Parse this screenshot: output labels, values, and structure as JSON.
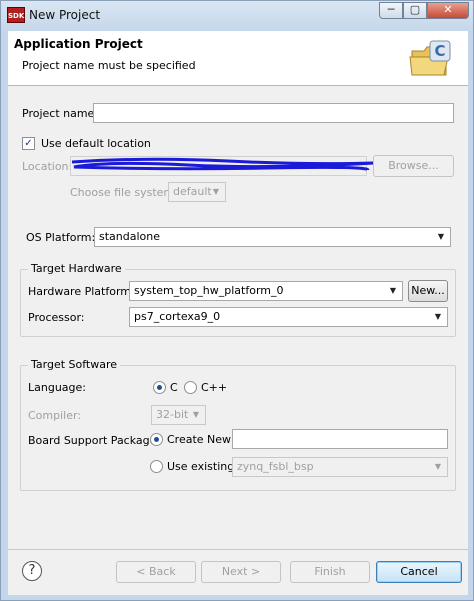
{
  "window": {
    "title": "New Project",
    "app_icon_text": "SDK",
    "min_glyph": "─",
    "max_glyph": "▢",
    "close_glyph": "✕"
  },
  "header": {
    "title": "Application Project",
    "message": "Project name must be specified",
    "icon": "folder-c-icon"
  },
  "project": {
    "name_label": "Project name:",
    "name_value": "",
    "use_default_label": "Use default location",
    "use_default_checked": true,
    "location_label": "Location:",
    "location_value": "",
    "browse_label": "Browse...",
    "file_system_label": "Choose file system:",
    "file_system_value": "default"
  },
  "os_platform": {
    "label": "OS Platform:",
    "value": "standalone"
  },
  "target_hardware": {
    "title": "Target Hardware",
    "platform_label": "Hardware Platform:",
    "platform_value": "system_top_hw_platform_0",
    "new_button": "New...",
    "processor_label": "Processor:",
    "processor_value": "ps7_cortexa9_0"
  },
  "target_software": {
    "title": "Target Software",
    "language_label": "Language:",
    "lang_c": "C",
    "lang_cpp": "C++",
    "selected_language": "C",
    "compiler_label": "Compiler:",
    "compiler_value": "32-bit",
    "bsp_label": "Board Support Package:",
    "create_new_label": "Create New",
    "create_new_value": "",
    "use_existing_label": "Use existing",
    "use_existing_value": "zynq_fsbl_bsp",
    "selected_bsp": "Create New"
  },
  "footer": {
    "help_glyph": "?",
    "back": "< Back",
    "next": "Next >",
    "finish": "Finish",
    "cancel": "Cancel"
  },
  "colors": {
    "redaction_scribble": "#1a1ad8",
    "default_button_border": "#3c7fb1"
  }
}
